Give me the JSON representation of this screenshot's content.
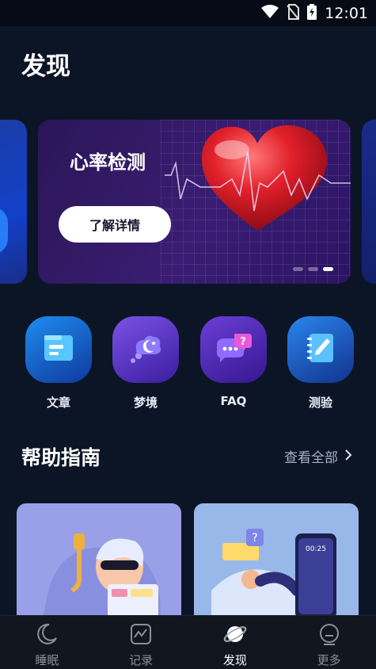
{
  "status_bar": {
    "time": "12:01",
    "icons": [
      "wifi-icon",
      "no-sim-icon",
      "battery-charging-icon"
    ]
  },
  "page": {
    "title": "发现"
  },
  "banner": {
    "title": "心率检测",
    "button_label": "了解详情",
    "page_count": 3,
    "active_index": 2,
    "art": "heart-icon"
  },
  "quick_links": [
    {
      "label": "文章",
      "icon": "article-icon",
      "color": "#1e7fe8"
    },
    {
      "label": "梦境",
      "icon": "dream-cloud-icon",
      "color": "#7b52e6"
    },
    {
      "label": "FAQ",
      "icon": "faq-bubble-icon",
      "color": "#6b3fd6"
    },
    {
      "label": "测验",
      "icon": "quiz-notebook-icon",
      "color": "#2874e0"
    }
  ],
  "help_guide": {
    "title": "帮助指南",
    "view_all_label": "查看全部",
    "cards": [
      {
        "art": "sleep-mask-illustration"
      },
      {
        "art": "sleep-phone-illustration",
        "phone_time": "00:25"
      }
    ]
  },
  "bottom_nav": {
    "items": [
      {
        "label": "睡眠",
        "icon": "moon-icon",
        "active": false
      },
      {
        "label": "记录",
        "icon": "chart-record-icon",
        "active": false
      },
      {
        "label": "发现",
        "icon": "planet-icon",
        "active": true
      },
      {
        "label": "更多",
        "icon": "more-face-icon",
        "active": false
      }
    ]
  }
}
